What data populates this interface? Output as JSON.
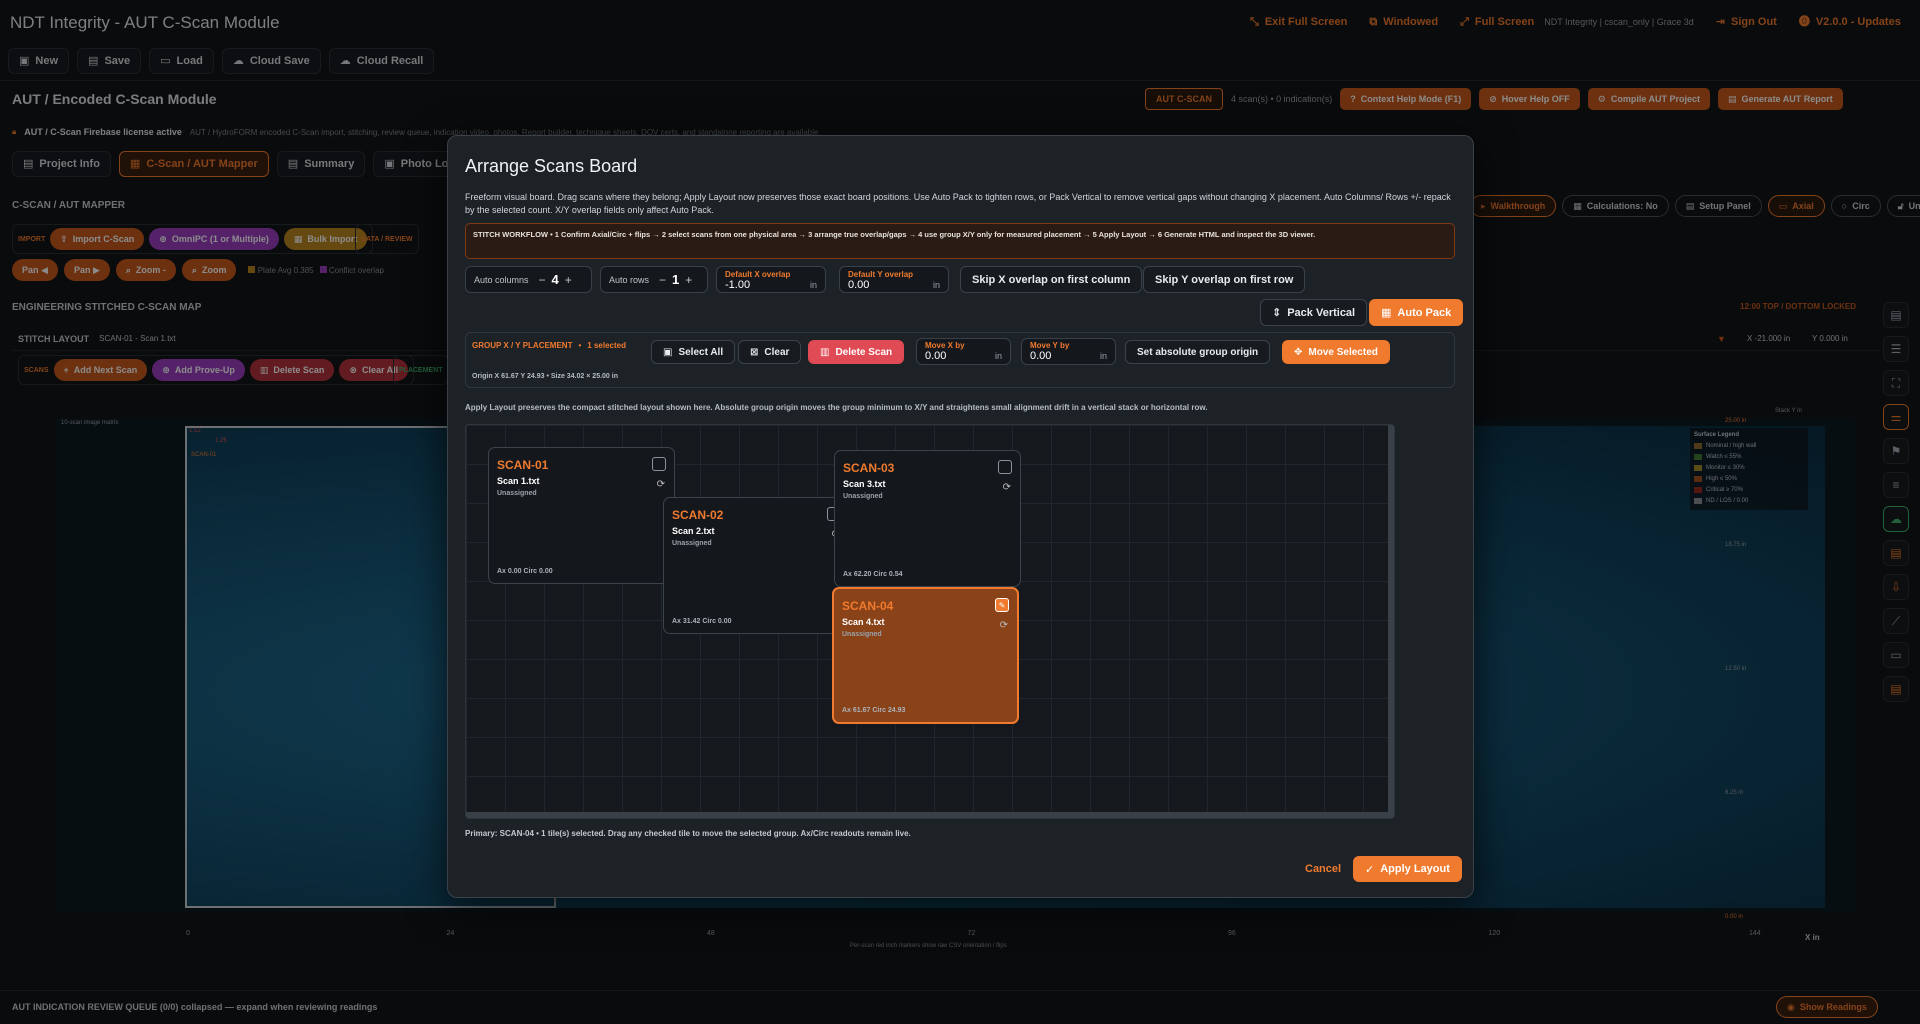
{
  "app": {
    "title": "NDT Integrity - AUT C-Scan Module",
    "window_actions": [
      {
        "icon": "exit-fullscreen-icon",
        "label": "Exit Full Screen"
      },
      {
        "icon": "windowed-icon",
        "label": "Windowed"
      },
      {
        "icon": "fullscreen-icon",
        "label": "Full Screen"
      }
    ],
    "user_info": "NDT Integrity | cscan_only | Grace 3d",
    "sign_out": "Sign Out",
    "version": "V2.0.0 - Updates"
  },
  "file_toolbar": {
    "buttons": [
      {
        "icon": "new-icon",
        "label": "New"
      },
      {
        "icon": "save-icon",
        "label": "Save"
      },
      {
        "icon": "load-icon",
        "label": "Load"
      },
      {
        "icon": "cloud-save-icon",
        "label": "Cloud Save"
      },
      {
        "icon": "cloud-recall-icon",
        "label": "Cloud Recall"
      }
    ]
  },
  "module": {
    "title": "AUT / Encoded C-Scan Module",
    "badge": "AUT C-SCAN",
    "counts": "4 scan(s) • 0 indication(s)",
    "actions": [
      {
        "icon": "help-icon",
        "label": "Context Help Mode (F1)"
      },
      {
        "icon": "hover-help-icon",
        "label": "Hover Help OFF"
      },
      {
        "icon": "compile-icon",
        "label": "Compile AUT Project"
      },
      {
        "icon": "report-icon",
        "label": "Generate AUT Report"
      }
    ],
    "license_title": "AUT / C-Scan Firebase license active",
    "license_text": "AUT / HydroFORM encoded C-Scan import, stitching, review queue, indication video, photos, Report builder, technique sheets, DOV certs, and standalone reporting are available."
  },
  "tabs": [
    {
      "icon": "project-info-icon",
      "label": "Project Info",
      "active": false
    },
    {
      "icon": "cscan-icon",
      "label": "C-Scan / AUT Mapper",
      "active": true
    },
    {
      "icon": "summary-icon",
      "label": "Summary",
      "active": false
    },
    {
      "icon": "photo-icon",
      "label": "Photo Log",
      "active": false
    }
  ],
  "mapper": {
    "section_title": "C-SCAN / AUT MAPPER",
    "import_label": "IMPORT",
    "import_buttons": [
      "Import C-Scan",
      "OmniPC (1 or Multiple)",
      "Bulk Import"
    ],
    "data_review_label": "DATA / REVIEW",
    "right_buttons": [
      "Walkthrough",
      "Calculations: No",
      "Setup Panel",
      "Axial",
      "Circ",
      "Unlocked"
    ],
    "view_buttons": [
      "Pan ◀",
      "Pan ▶",
      "Zoom -",
      "Zoom"
    ],
    "plate_avg": "Plate Avg 0.385",
    "conflict": "Conflict overlap",
    "map_title": "ENGINEERING STITCHED C-SCAN MAP",
    "locked_note": "12:00 TOP / DOTTOM LOCKED",
    "stitch_layout_label": "STITCH LAYOUT",
    "stitch_layout_value": "SCAN-01 - Scan 1.txt",
    "x_readout": "X -21.000 in",
    "y_readout": "Y 0.000 in",
    "scans_label": "SCANS",
    "scan_buttons": [
      "Add Next Scan",
      "Add Prove-Up",
      "Delete Scan",
      "Clear All"
    ],
    "placement_label": "PLACEMENT",
    "image_matrix_label": "10-scan image matrix",
    "stack_label": "Stack Y in",
    "tile_corner_a": "1.12",
    "tile_corner_b": "1.25",
    "tile_id": "SCAN-01",
    "y_ticks": [
      "25.00 in",
      "18.75 in",
      "12.50 in",
      "6.25 in",
      "0.00 in"
    ],
    "x_ticks": [
      "0",
      "24",
      "48",
      "72",
      "96",
      "120",
      "144"
    ],
    "x_axis_label": "X in",
    "x_note": "Per-scan red inch markers show raw CSV orientation / flips",
    "legend_title": "Surface Legend",
    "legend": [
      {
        "label": "Nominal / high wall",
        "color": "#8e6a2c"
      },
      {
        "label": "Watch ≤ 55%",
        "color": "#3f7a32"
      },
      {
        "label": "Monitor ≤ 30%",
        "color": "#a58a2a"
      },
      {
        "label": "High ≤ 50%",
        "color": "#a0541e"
      },
      {
        "label": "Critical ≥ 70%",
        "color": "#9a2a22"
      },
      {
        "label": "ND / LOS / 0.00",
        "color": "#8a8f94"
      }
    ],
    "review_queue": "AUT INDICATION REVIEW QUEUE (0/0) collapsed — expand when reviewing readings",
    "show_readings": "Show Readings"
  },
  "side_icons": [
    "layout-icon",
    "list-icon",
    "fit-icon",
    "sliders-icon",
    "flag-icon",
    "notes-icon",
    "cloud-icon",
    "book-icon",
    "download-icon",
    "chart-icon",
    "ruler-icon",
    "report-icon"
  ],
  "modal": {
    "title": "Arrange Scans Board",
    "description": "Freeform visual board. Drag scans where they belong; Apply Layout now preserves those exact board positions. Use Auto Pack to tighten rows, or Pack Vertical to remove vertical gaps without changing X placement. Auto Columns/ Rows +/- repack by the selected count. X/Y overlap fields only affect Auto Pack.",
    "workflow": "STITCH WORKFLOW  •  1 Confirm Axial/Circ + flips → 2 select scans from one physical area → 3 arrange true overlap/gaps → 4 use group X/Y only for measured placement → 5 Apply Layout → 6 Generate HTML and inspect the 3D viewer.",
    "auto_columns_label": "Auto columns",
    "auto_columns_value": "4",
    "auto_rows_label": "Auto rows",
    "auto_rows_value": "1",
    "x_overlap_label": "Default X overlap",
    "x_overlap_value": "-1.00",
    "y_overlap_label": "Default Y overlap",
    "y_overlap_value": "0.00",
    "unit": "in",
    "skip_x": "Skip X overlap on first column",
    "skip_y": "Skip Y overlap on first row",
    "pack_vertical": "Pack Vertical",
    "auto_pack": "Auto Pack",
    "group_label": "GROUP X / Y PLACEMENT",
    "selected_count": "1 selected",
    "select_all": "Select All",
    "clear": "Clear",
    "delete_scan": "Delete Scan",
    "move_x_label": "Move X by",
    "move_x_value": "0.00",
    "move_y_label": "Move Y by",
    "move_y_value": "0.00",
    "set_origin": "Set absolute group origin",
    "move_selected": "Move Selected",
    "origin_info": "Origin X 61.67  Y 24.93  •  Size 34.02 × 25.00 in",
    "layout_note": "Apply Layout preserves the compact stitched layout shown here. Absolute group origin moves the group minimum to X/Y and straightens small alignment drift in a vertical stack or horizontal row.",
    "tiles": [
      {
        "id": "SCAN-01",
        "file": "Scan 1.txt",
        "status": "Unassigned",
        "readout": "Ax 0.00  Circ 0.00",
        "selected": false
      },
      {
        "id": "SCAN-02",
        "file": "Scan 2.txt",
        "status": "Unassigned",
        "readout": "Ax 31.42  Circ 0.00",
        "selected": false
      },
      {
        "id": "SCAN-03",
        "file": "Scan 3.txt",
        "status": "Unassigned",
        "readout": "Ax 62.20  Circ 0.54",
        "selected": false
      },
      {
        "id": "SCAN-04",
        "file": "Scan 4.txt",
        "status": "Unassigned",
        "readout": "Ax 61.67  Circ 24.93",
        "selected": true
      }
    ],
    "footer_note": "Primary: SCAN-04  •  1 tile(s) selected. Drag any checked tile to move the selected group. Ax/Circ readouts remain live.",
    "cancel": "Cancel",
    "apply": "Apply Layout"
  },
  "colors": {
    "accent": "#f07a2e",
    "danger": "#e04a55",
    "purple": "#9b3fbf",
    "bg": "#111417",
    "modal_bg": "#1d2227"
  }
}
